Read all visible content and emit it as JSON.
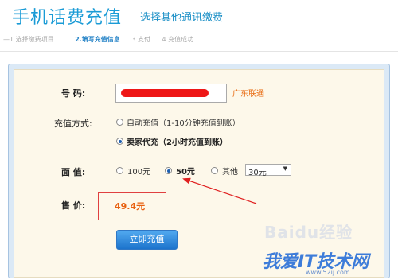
{
  "header": {
    "title": "手机话费充值",
    "subtitle": "选择其他通讯缴费"
  },
  "steps": [
    {
      "label": "1.选择缴费项目",
      "active": false
    },
    {
      "label": "2.填写充值信息",
      "active": true
    },
    {
      "label": "3.支付",
      "active": false
    },
    {
      "label": "4.充值成功",
      "active": false
    }
  ],
  "form": {
    "number_label": "号    码:",
    "carrier": "广东联通",
    "method_label": "充值方式:",
    "methods": [
      {
        "label": "自动充值（1-10分钟充值到账）",
        "selected": false
      },
      {
        "label": "卖家代充（2小时充值到账）",
        "selected": true
      }
    ],
    "face_value_label": "面    值:",
    "face_values": [
      {
        "label": "100元",
        "selected": false
      },
      {
        "label": "50元",
        "selected": true
      },
      {
        "label": "其他",
        "selected": false
      }
    ],
    "other_amount": "30元",
    "price_label": "售    价:",
    "price": "49.4元",
    "submit_label": "立即充值"
  },
  "watermark": {
    "baidu": "Baidu经验",
    "site": "我爱IT技术网",
    "url": "www.52ij.com"
  },
  "colors": {
    "accent": "#1a9bd6",
    "price": "#e8600f",
    "annotation": "#e02020"
  }
}
